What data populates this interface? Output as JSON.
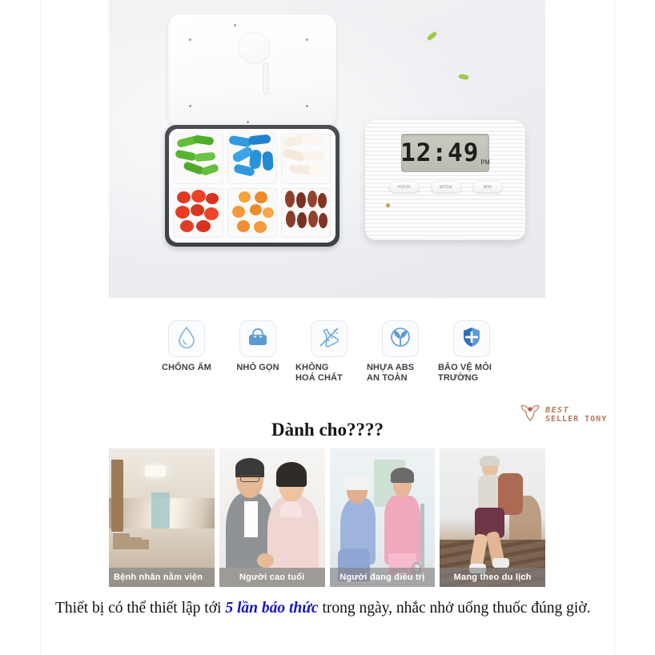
{
  "hero": {
    "alt": "Hộp thuốc hẹn giờ và thiết bị báo thức",
    "device": {
      "lcd_time": "12:49",
      "lcd_pm": "PM",
      "buttons": [
        "HOUR",
        "MODE",
        "MIN"
      ]
    },
    "compartments": [
      {
        "name": "green-capsules",
        "color": "#5ab432"
      },
      {
        "name": "blue-capsules",
        "color": "#2e97e0"
      },
      {
        "name": "white-capsules",
        "color": "#f7efe6"
      },
      {
        "name": "red-pills",
        "color": "#e03522"
      },
      {
        "name": "orange-pills",
        "color": "#f2962f"
      },
      {
        "name": "brown-pills",
        "color": "#8a3b2a"
      }
    ]
  },
  "features": [
    {
      "icon": "water-drop-icon",
      "label": "CHỐNG ẨM"
    },
    {
      "icon": "handbag-icon",
      "label": "NHỎ GỌN"
    },
    {
      "icon": "no-chemicals-flask-icon",
      "label": "KHÔNG\nHOÁ CHẤT"
    },
    {
      "icon": "leaf-circle-icon",
      "label": "NHỰA ABS\nAN TOÀN"
    },
    {
      "icon": "shield-icon",
      "label": "BẢO VỆ MÔI\nTRƯỜNG"
    }
  ],
  "brand": {
    "icon": "owl-logo-icon",
    "line1": "BEST",
    "line2": "SELLER TONY",
    "color": "#b4785d"
  },
  "heading": "Dành cho????",
  "thumbnails": [
    {
      "caption": "Bệnh nhân nằm viện",
      "image": "hospital-corridor"
    },
    {
      "caption": "Người cao tuổi",
      "image": "elderly-couple"
    },
    {
      "caption": "Người đang điều trị",
      "image": "nurse-with-patient"
    },
    {
      "caption": "Mang theo du lịch",
      "image": "traveler-with-backpack"
    }
  ],
  "paragraph": {
    "part1": "Thiết bị có thể thiết lập tới ",
    "highlight": "5 lần báo thức",
    "part2": " trong ngày, nhắc nhở uống thuốc đúng giờ.",
    "highlight_color": "#1515bb"
  }
}
